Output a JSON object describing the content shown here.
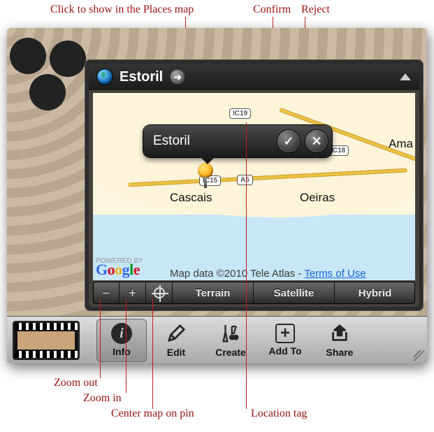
{
  "annotations": {
    "show_in_places": "Click to show in the Places map",
    "confirm": "Confirm",
    "reject": "Reject",
    "zoom_out": "Zoom out",
    "zoom_in": "Zoom in",
    "center_pin": "Center map on pin",
    "location_tag": "Location tag"
  },
  "panel": {
    "title": "Estoril"
  },
  "popover": {
    "text": "Estoril"
  },
  "map": {
    "city1": "Cascais",
    "city2": "Oeiras",
    "city3": "Ama",
    "shield1": "IC19",
    "shield2": "IC18",
    "shield3": "IC15",
    "shield4": "A5",
    "powered_by": "POWERED BY",
    "attribution": "Map data ©2010 Tele Atlas - ",
    "terms": "Terms of Use"
  },
  "map_controls": {
    "minus": "−",
    "plus": "+",
    "terrain": "Terrain",
    "satellite": "Satellite",
    "hybrid": "Hybrid"
  },
  "toolbar": {
    "info": "Info",
    "edit": "Edit",
    "create": "Create",
    "addto": "Add To",
    "share": "Share"
  }
}
